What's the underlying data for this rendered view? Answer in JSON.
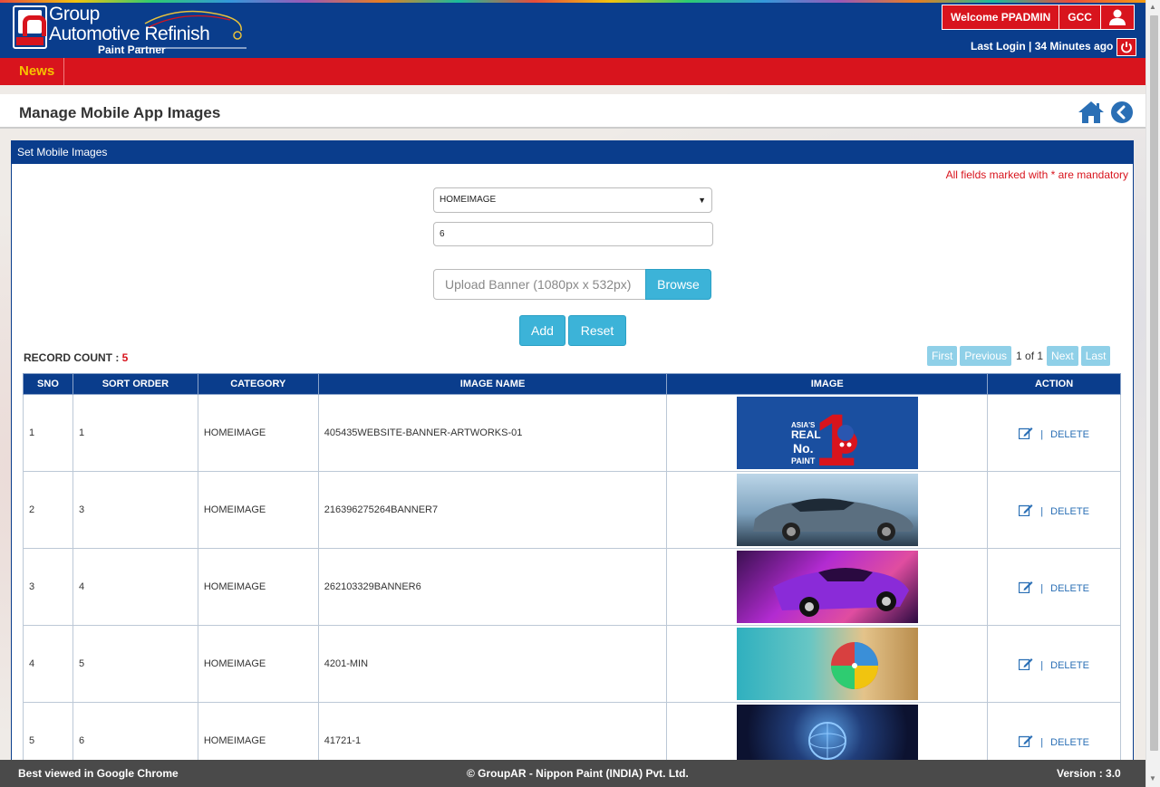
{
  "header": {
    "brand_line1": "Group",
    "brand_line2": "Automotive Refinish",
    "brand_sub": "Paint Partner",
    "welcome": "Welcome PPADMIN",
    "region": "GCC",
    "last_login": "Last Login | 34 Minutes ago"
  },
  "nav": {
    "items": [
      {
        "label": "News"
      }
    ]
  },
  "page": {
    "title": "Manage Mobile App Images"
  },
  "panel": {
    "title": "Set Mobile Images",
    "mandatory_note": "All fields marked with * are mandatory",
    "category_select": "HOMEIMAGE",
    "sort_order_value": "6",
    "upload_placeholder": "Upload Banner (1080px x 532px)",
    "browse_label": "Browse",
    "add_label": "Add",
    "reset_label": "Reset",
    "record_count_label": "RECORD COUNT :",
    "record_count": "5",
    "pager": {
      "first": "First",
      "previous": "Previous",
      "info": "1 of 1",
      "next": "Next",
      "last": "Last"
    }
  },
  "table": {
    "headers": [
      "SNO",
      "SORT ORDER",
      "CATEGORY",
      "IMAGE NAME",
      "IMAGE",
      "ACTION"
    ],
    "rows": [
      {
        "sno": "1",
        "sort_order": "1",
        "category": "HOMEIMAGE",
        "image_name": "405435WEBSITE-BANNER-ARTWORKS-01",
        "delete": "DELETE"
      },
      {
        "sno": "2",
        "sort_order": "3",
        "category": "HOMEIMAGE",
        "image_name": "216396275264BANNER7",
        "delete": "DELETE"
      },
      {
        "sno": "3",
        "sort_order": "4",
        "category": "HOMEIMAGE",
        "image_name": "262103329BANNER6",
        "delete": "DELETE"
      },
      {
        "sno": "4",
        "sort_order": "5",
        "category": "HOMEIMAGE",
        "image_name": "4201-MIN",
        "delete": "DELETE"
      },
      {
        "sno": "5",
        "sort_order": "6",
        "category": "HOMEIMAGE",
        "image_name": "41721-1",
        "delete": "DELETE"
      }
    ],
    "action_separator": "|"
  },
  "banner1_text": {
    "line1": "ASIA'S",
    "line2": "REAL",
    "line3": "No.",
    "line4": "PAINT",
    "number": "1"
  },
  "footer": {
    "left": "Best viewed in Google Chrome",
    "center": "© GroupAR - Nippon Paint (INDIA) Pvt. Ltd.",
    "right": "Version : 3.0"
  },
  "colors": {
    "primary": "#0a3d8c",
    "accent_red": "#d8141d",
    "button": "#3cb3d8",
    "news": "#f6c200"
  },
  "icons": [
    "user-icon",
    "power-icon",
    "home-icon",
    "back-icon",
    "edit-icon"
  ]
}
